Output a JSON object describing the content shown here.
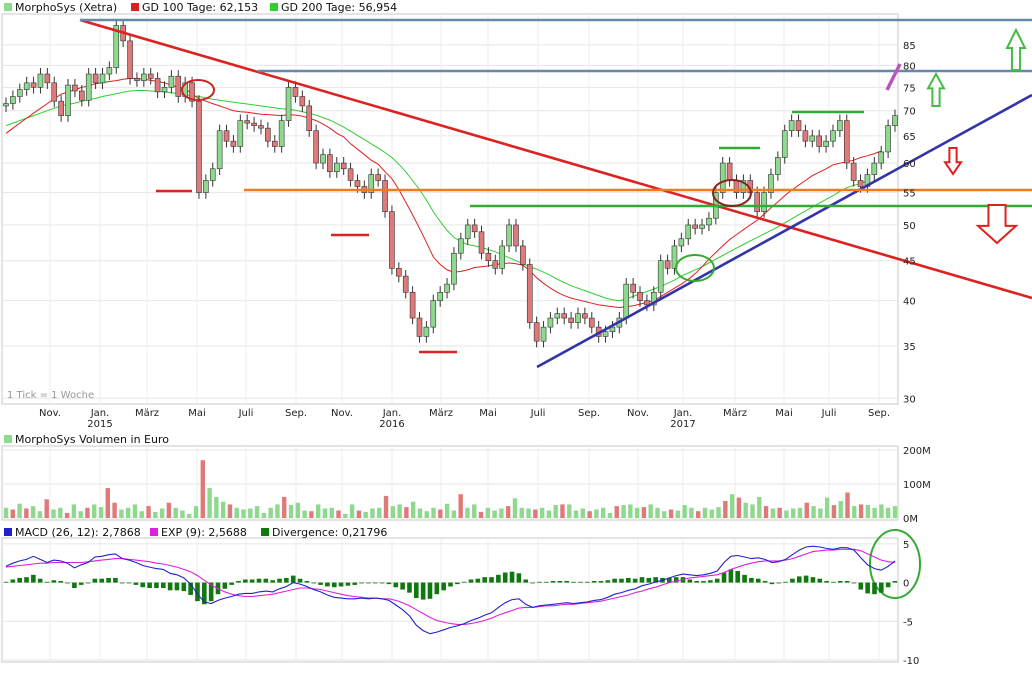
{
  "chart_data": [
    {
      "type": "candlestick",
      "legend": [
        {
          "label": "MorphoSys (Xetra)",
          "color": "#8fd98f"
        },
        {
          "label": "GD 100 Tage: 62,153",
          "color": "#e02020"
        },
        {
          "label": "GD 200 Tage: 56,954",
          "color": "#33cc33"
        }
      ],
      "x_ticks": [
        "Nov.",
        "Jan.",
        "März",
        "Mai",
        "Juli",
        "Sep.",
        "Nov.",
        "Jan.",
        "März",
        "Mai",
        "Juli",
        "Sep.",
        "Nov.",
        "Jan.",
        "März",
        "Mai",
        "Juli",
        "Sep."
      ],
      "x_years": [
        "2015",
        "2016",
        "2017"
      ],
      "y_scale": "log",
      "y_ticks": [
        30,
        35,
        40,
        45,
        50,
        55,
        60,
        65,
        70,
        75,
        80,
        85
      ],
      "ylim": [
        29.5,
        92
      ],
      "watermark": "1 Tick = 1 Woche",
      "series_close": [
        71.5,
        73,
        74.5,
        76,
        75,
        78,
        76,
        72,
        69,
        75.5,
        74.2,
        72.2,
        78,
        76,
        78,
        79.5,
        90,
        86,
        77,
        76.5,
        78,
        77,
        74,
        75,
        77.5,
        73,
        76,
        72,
        55,
        57,
        59,
        66,
        64,
        63,
        68,
        67.5,
        67,
        66.5,
        64,
        63,
        68,
        75,
        73,
        71,
        66,
        60,
        61.5,
        58.5,
        60,
        59,
        57,
        56,
        55,
        58,
        57,
        52,
        44,
        43,
        41,
        38,
        36,
        37,
        40,
        41,
        42,
        46,
        48,
        50,
        49,
        46,
        45,
        44,
        47,
        50,
        47,
        44.5,
        37.5,
        35.5,
        37,
        38,
        38.5,
        38,
        37.5,
        38.5,
        38,
        37,
        36,
        36.5,
        37,
        38,
        42,
        41,
        40,
        39.5,
        41,
        45,
        44,
        47,
        48,
        50,
        49.5,
        50,
        51,
        55,
        60,
        57,
        55,
        57,
        55,
        52,
        55,
        58,
        61,
        66,
        68,
        66,
        64,
        65,
        63,
        64,
        66,
        68,
        60,
        57,
        56,
        58,
        60,
        62,
        67,
        69
      ],
      "gd100": [
        65.5,
        66.5,
        67.5,
        68.5,
        69.5,
        70.5,
        71.5,
        72.5,
        73.5,
        74,
        74.5,
        75,
        75.3,
        75.8,
        76,
        76.3,
        76.5,
        76.8,
        77,
        77,
        76.8,
        76.6,
        76.3,
        76,
        75.5,
        75,
        74.8,
        73.5,
        72.5,
        72,
        71.5,
        71,
        70.5,
        70,
        69.8,
        69.7,
        69.5,
        69.3,
        69.2,
        69.1,
        69,
        69.2,
        69.1,
        68.9,
        68.5,
        68,
        67.3,
        66.5,
        65.5,
        64.8,
        63.5,
        62.5,
        61.5,
        60.5,
        59.8,
        58.5,
        57.3,
        55.5,
        53.5,
        51.5,
        49.5,
        47.5,
        45.5,
        44.5,
        43.8,
        43.5,
        43.6,
        43.8,
        44.1,
        44.2,
        44.3,
        44.5,
        44.6,
        44.7,
        44.6,
        44.4,
        43.7,
        42.8,
        42.1,
        41.5,
        41,
        40.6,
        40.3,
        40.1,
        39.9,
        39.7,
        39.5,
        39.4,
        39.3,
        39.2,
        39.3,
        39.4,
        39.6,
        39.8,
        40,
        40.5,
        41,
        41.5,
        42,
        42.6,
        43.3,
        44.2,
        45.2,
        46.1,
        47,
        47.9,
        48.6,
        49.3,
        50,
        50.7,
        51.6,
        52.6,
        53.5,
        54.5,
        55.4,
        56.2,
        57,
        57.8,
        58.4,
        59,
        59.7,
        60,
        60.2,
        60.5,
        61,
        61.3,
        61.7,
        62.15
      ],
      "gd200": [
        67,
        67.5,
        68,
        68.5,
        69,
        69.5,
        70,
        70.5,
        71,
        71.3,
        71.6,
        72,
        72.3,
        72.6,
        73,
        73.3,
        73.6,
        73.9,
        74.2,
        74.3,
        74.3,
        74.2,
        74.1,
        74,
        73.8,
        73.6,
        73.4,
        73.2,
        73,
        72.7,
        72.4,
        72.2,
        72,
        71.8,
        71.6,
        71.4,
        71.2,
        71,
        70.8,
        70.6,
        70.4,
        70.3,
        70.1,
        69.8,
        69.5,
        69.1,
        68.6,
        68.1,
        67.4,
        66.7,
        65.9,
        65.1,
        64.3,
        63.5,
        62.7,
        61.9,
        61,
        59.8,
        58.5,
        57,
        55.5,
        53.8,
        52,
        50.5,
        49.2,
        48.2,
        47.6,
        47.2,
        47,
        46.8,
        46.5,
        46.2,
        45.8,
        45.4,
        45,
        44.6,
        44.2,
        43.9,
        43.5,
        43.1,
        42.6,
        42.2,
        41.8,
        41.5,
        41.2,
        40.9,
        40.6,
        40.3,
        40.1,
        40,
        40.2,
        40.5,
        40.8,
        41.1,
        41.4,
        41.7,
        42.1,
        42.5,
        43,
        43.4,
        43.8,
        44.2,
        44.7,
        45.2,
        45.7,
        46.2,
        46.7,
        47.2,
        47.7,
        48.2,
        48.7,
        49.2,
        49.7,
        50.3,
        50.9,
        51.5,
        52.1,
        52.7,
        53.3,
        53.9,
        54.5,
        55.2,
        55.8,
        56.2,
        56.5,
        56.9
      ]
    },
    {
      "type": "bar",
      "legend": [
        {
          "label": "MorphoSys Volumen in Euro",
          "color": "#8fd98f"
        }
      ],
      "y_ticks": [
        "0M",
        "100M",
        "200M"
      ],
      "ylim": [
        0,
        200
      ],
      "colors": {
        "up": "#8fd98f",
        "down": "#e07a7a"
      },
      "values": [
        30,
        25,
        42,
        28,
        35,
        20,
        55,
        25,
        30,
        15,
        40,
        20,
        30,
        40,
        32,
        88,
        45,
        25,
        30,
        40,
        20,
        35,
        18,
        28,
        45,
        30,
        22,
        12,
        35,
        170,
        88,
        62,
        48,
        40,
        30,
        25,
        28,
        35,
        15,
        30,
        40,
        62,
        38,
        45,
        22,
        20,
        40,
        28,
        30,
        22,
        12,
        40,
        22,
        18,
        28,
        30,
        65,
        35,
        40,
        32,
        48,
        28,
        20,
        30,
        25,
        42,
        22,
        70,
        30,
        40,
        18,
        30,
        22,
        28,
        35,
        58,
        30,
        28,
        25,
        30,
        22,
        38,
        40,
        40,
        22,
        28,
        20,
        25,
        30,
        15,
        35,
        38,
        40,
        30,
        32,
        40,
        30,
        20,
        25,
        22,
        38,
        30,
        20,
        30,
        25,
        32,
        50,
        70,
        60,
        45,
        40,
        62,
        35,
        28,
        30,
        22,
        28,
        30,
        45,
        35,
        28,
        60,
        38,
        50,
        75,
        35,
        40,
        38,
        30,
        40,
        30,
        35
      ],
      "down_idx": [
        1,
        3,
        6,
        9,
        12,
        15,
        16,
        21,
        24,
        29,
        33,
        41,
        45,
        49,
        52,
        56,
        59,
        64,
        67,
        70,
        74,
        78,
        82,
        86,
        90,
        94,
        98,
        102,
        106,
        108,
        112,
        114,
        118,
        122,
        124,
        126
      ]
    },
    {
      "type": "line",
      "legend": [
        {
          "label": "MACD (26, 12): 2,7868",
          "color": "#2222cc"
        },
        {
          "label": "EXP (9): 2,5688",
          "color": "#dd22dd"
        },
        {
          "label": "Divergence: 0,21796",
          "color": "#117711"
        }
      ],
      "y_ticks": [
        -10,
        -5,
        0,
        5
      ],
      "ylim": [
        -10,
        5.5
      ],
      "macd": [
        2.1,
        2.5,
        2.8,
        3.0,
        3.4,
        3.0,
        2.6,
        2.9,
        2.8,
        2.5,
        1.9,
        2.3,
        2.6,
        3.3,
        3.4,
        3.6,
        3.7,
        3.1,
        2.9,
        2.6,
        2.2,
        2.0,
        1.8,
        1.7,
        1.2,
        1.0,
        0.6,
        -0.2,
        -1.5,
        -2.5,
        -2.7,
        -2.3,
        -2.0,
        -1.8,
        -1.5,
        -1.4,
        -1.4,
        -1.2,
        -1.1,
        -1.2,
        -0.8,
        -0.5,
        0.0,
        -0.2,
        -0.5,
        -0.9,
        -1.2,
        -1.6,
        -1.9,
        -2.0,
        -2.1,
        -2.1,
        -2.0,
        -2.1,
        -2.0,
        -2.1,
        -2.3,
        -2.9,
        -3.5,
        -4.3,
        -5.5,
        -6.2,
        -6.6,
        -6.4,
        -6.1,
        -5.8,
        -5.6,
        -5.3,
        -4.9,
        -4.6,
        -4.2,
        -3.9,
        -3.2,
        -2.6,
        -2.2,
        -2.1,
        -2.8,
        -3.2,
        -3.0,
        -2.9,
        -2.8,
        -2.7,
        -2.6,
        -2.7,
        -2.6,
        -2.5,
        -2.3,
        -2.2,
        -1.9,
        -1.5,
        -1.3,
        -1.0,
        -0.8,
        -0.4,
        -0.2,
        0.1,
        0.3,
        0.6,
        0.9,
        1.1,
        1.0,
        0.9,
        1.0,
        1.2,
        1.5,
        2.6,
        3.4,
        3.5,
        3.3,
        3.1,
        3.2,
        3.0,
        2.6,
        2.7,
        3.0,
        3.6,
        4.2,
        4.6,
        4.7,
        4.6,
        4.4,
        4.3,
        4.5,
        4.5,
        4.2,
        3.2,
        2.3,
        1.8,
        1.6,
        2.1,
        2.8
      ],
      "signal": [
        2.0,
        2.1,
        2.2,
        2.3,
        2.4,
        2.5,
        2.5,
        2.6,
        2.6,
        2.6,
        2.6,
        2.6,
        2.7,
        2.8,
        2.9,
        3.0,
        3.1,
        3.1,
        3.0,
        2.9,
        2.8,
        2.7,
        2.5,
        2.4,
        2.2,
        2.0,
        1.7,
        1.4,
        0.9,
        0.3,
        -0.3,
        -0.8,
        -1.2,
        -1.5,
        -1.7,
        -1.8,
        -1.8,
        -1.7,
        -1.6,
        -1.5,
        -1.3,
        -1.1,
        -0.9,
        -0.7,
        -0.7,
        -0.8,
        -0.9,
        -1.1,
        -1.3,
        -1.5,
        -1.7,
        -1.8,
        -1.9,
        -2.0,
        -2.0,
        -2.1,
        -2.1,
        -2.3,
        -2.6,
        -3.0,
        -3.5,
        -4.0,
        -4.5,
        -4.9,
        -5.1,
        -5.3,
        -5.4,
        -5.4,
        -5.3,
        -5.1,
        -4.9,
        -4.6,
        -4.2,
        -3.9,
        -3.6,
        -3.3,
        -3.2,
        -3.2,
        -3.1,
        -3.0,
        -3.0,
        -2.9,
        -2.8,
        -2.8,
        -2.7,
        -2.6,
        -2.5,
        -2.4,
        -2.2,
        -2.0,
        -1.8,
        -1.6,
        -1.3,
        -1.1,
        -0.8,
        -0.6,
        -0.3,
        0.0,
        0.2,
        0.4,
        0.6,
        0.7,
        0.8,
        0.9,
        1.0,
        1.3,
        1.7,
        2.0,
        2.3,
        2.5,
        2.7,
        2.8,
        2.8,
        2.8,
        2.9,
        3.1,
        3.4,
        3.7,
        4.0,
        4.1,
        4.2,
        4.2,
        4.3,
        4.3,
        4.3,
        4.1,
        3.7,
        3.3,
        2.9,
        2.7,
        2.6
      ]
    }
  ]
}
